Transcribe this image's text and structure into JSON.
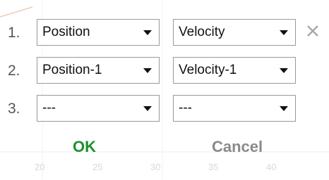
{
  "rows": [
    {
      "number": "1.",
      "first": "Position",
      "second": "Velocity",
      "removable": true
    },
    {
      "number": "2.",
      "first": "Position-1",
      "second": "Velocity-1",
      "removable": false
    },
    {
      "number": "3.",
      "first": "---",
      "second": "---",
      "removable": false
    }
  ],
  "icons": {
    "remove": "close-icon",
    "dropdown": "chevron-down-icon"
  },
  "buttons": {
    "ok": "OK",
    "cancel": "Cancel"
  },
  "background_axis_ticks": [
    "20",
    "25",
    "30",
    "35",
    "40"
  ],
  "colors": {
    "ok": "#1e8f2d",
    "cancel": "#8a8a8a",
    "border": "#999999",
    "remove_icon": "#a8a8a8"
  }
}
